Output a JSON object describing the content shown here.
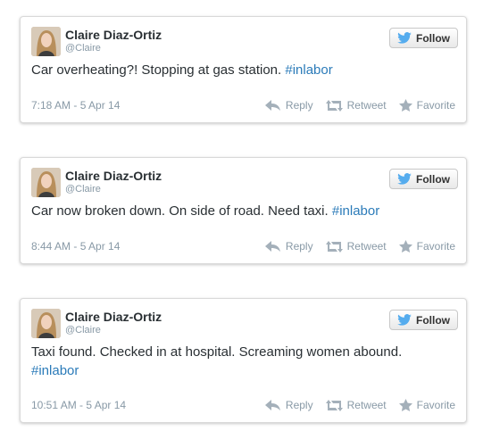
{
  "tweets": [
    {
      "name": "Claire Diaz-Ortiz",
      "handle": "@Claire",
      "follow_label": "Follow",
      "text": "Car overheating?! Stopping at gas station.",
      "hashtag": "#inlabor",
      "timestamp": "7:18 AM - 5 Apr 14",
      "reply_label": "Reply",
      "retweet_label": "Retweet",
      "favorite_label": "Favorite"
    },
    {
      "name": "Claire Diaz-Ortiz",
      "handle": "@Claire",
      "follow_label": "Follow",
      "text": "Car now broken down. On side of road. Need taxi.",
      "hashtag": "#inlabor",
      "timestamp": "8:44 AM - 5 Apr 14",
      "reply_label": "Reply",
      "retweet_label": "Retweet",
      "favorite_label": "Favorite"
    },
    {
      "name": "Claire Diaz-Ortiz",
      "handle": "@Claire",
      "follow_label": "Follow",
      "text": "Taxi found. Checked in at hospital. Screaming women abound.",
      "hashtag": "#inlabor",
      "timestamp": "10:51 AM - 5 Apr 14",
      "reply_label": "Reply",
      "retweet_label": "Retweet",
      "favorite_label": "Favorite"
    }
  ],
  "colors": {
    "twitter_blue": "#55acee",
    "hashtag": "#2b7bb9",
    "muted": "#8899a6"
  },
  "icons": {
    "follow": "twitter-bird-icon",
    "reply": "reply-arrow-icon",
    "retweet": "retweet-icon",
    "favorite": "star-icon"
  }
}
